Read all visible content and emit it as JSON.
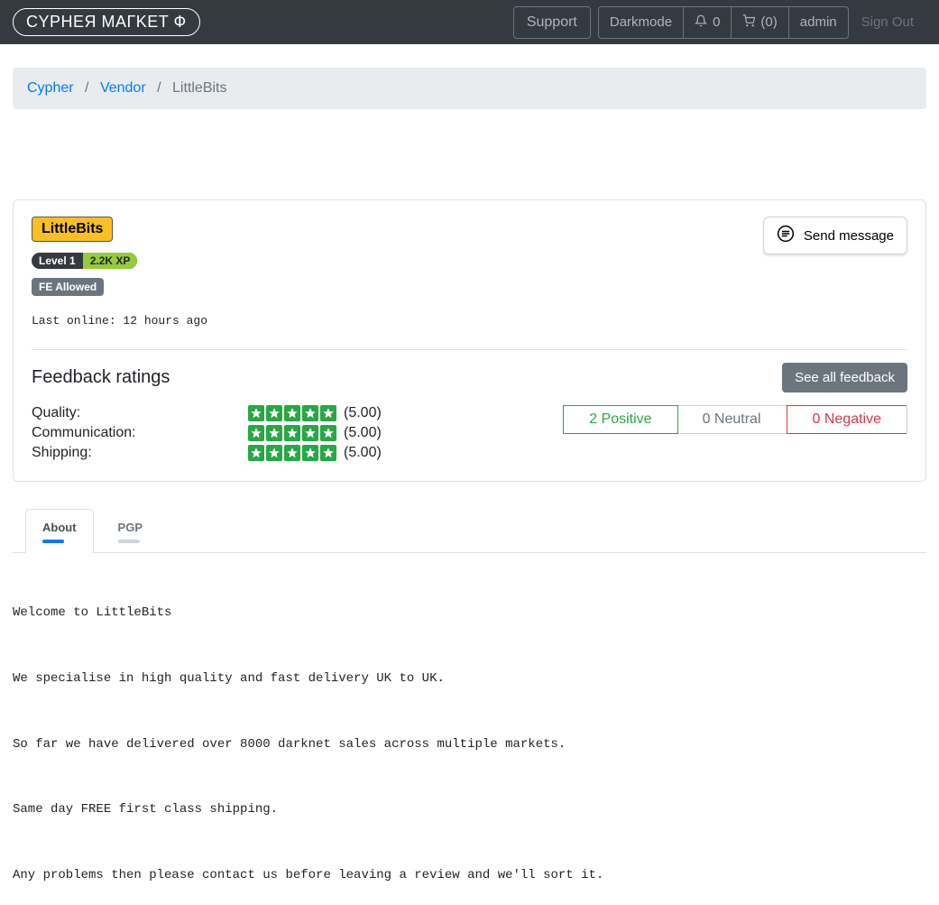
{
  "nav": {
    "logo": "CYPHEЯ MAГKET Ф",
    "support": "Support",
    "darkmode": "Darkmode",
    "notif_count": "0",
    "cart_label": "(0)",
    "username": "admin",
    "signout": "Sign Out"
  },
  "breadcrumb": {
    "root": "Cypher",
    "vendor": "Vendor",
    "current": "LittleBits"
  },
  "vendor": {
    "name": "LittleBits",
    "level": "Level 1",
    "xp": "2.2K XP",
    "fe": "FE Allowed",
    "last_online": "Last online: 12 hours ago",
    "send_message": "Send message"
  },
  "feedback": {
    "heading": "Feedback ratings",
    "see_all": "See all feedback",
    "rows": [
      {
        "label": "Quality:",
        "score": "(5.00)"
      },
      {
        "label": "Communication:",
        "score": "(5.00)"
      },
      {
        "label": "Shipping:",
        "score": "(5.00)"
      }
    ],
    "summary": {
      "positive": "2 Positive",
      "neutral": "0 Neutral",
      "negative": "0 Negative"
    }
  },
  "tabs": {
    "about": "About",
    "pgp": "PGP"
  },
  "about_text": "Welcome to LittleBits\n\nWe specialise in high quality and fast delivery UK to UK.\n\nSo far we have delivered over 8000 darknet sales across multiple markets.\n\nSame day FREE first class shipping.\n\nAny problems then please contact us before leaving a review and we'll sort it."
}
